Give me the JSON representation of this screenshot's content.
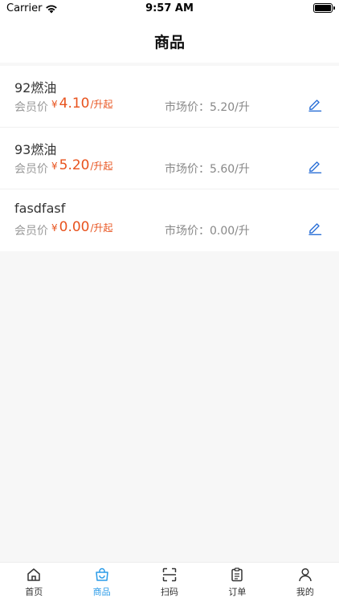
{
  "status": {
    "carrier": "Carrier",
    "time": "9:57 AM"
  },
  "nav": {
    "title": "商品"
  },
  "products": [
    {
      "name": "92燃油",
      "member_label": "会员价",
      "currency": "¥",
      "price": "4.10",
      "unit": "/升起",
      "market_label": "市场价：",
      "market_price": "5.20/升"
    },
    {
      "name": "93燃油",
      "member_label": "会员价",
      "currency": "¥",
      "price": "5.20",
      "unit": "/升起",
      "market_label": "市场价：",
      "market_price": "5.60/升"
    },
    {
      "name": "fasdfasf",
      "member_label": "会员价",
      "currency": "¥",
      "price": "0.00",
      "unit": "/升起",
      "market_label": "市场价：",
      "market_price": "0.00/升"
    }
  ],
  "tabs": [
    {
      "label": "首页",
      "icon": "home-icon"
    },
    {
      "label": "商品",
      "icon": "shopping-bag-icon",
      "active": true
    },
    {
      "label": "扫码",
      "icon": "scan-icon"
    },
    {
      "label": "订单",
      "icon": "clipboard-icon"
    },
    {
      "label": "我的",
      "icon": "user-icon"
    }
  ],
  "colors": {
    "accent": "#2a9be8",
    "price": "#e8531e",
    "edit": "#2a6fd6"
  }
}
